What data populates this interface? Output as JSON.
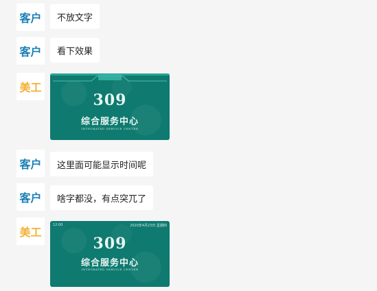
{
  "colors": {
    "customer": "#1a7fb6",
    "designer": "#f2b233",
    "card_bg": "#0f7a70"
  },
  "messages": [
    {
      "sender": "客户",
      "text": "不放文字"
    },
    {
      "sender": "客户",
      "text": "看下效果"
    },
    {
      "sender": "美工",
      "card": {
        "number": "309",
        "title": "综合服务中心",
        "subtitle": "INTEGRATED SERVICE CENTER"
      }
    },
    {
      "sender": "客户",
      "text": "这里面可能显示时间呢"
    },
    {
      "sender": "客户",
      "text": "啥字都没，有点突兀了"
    },
    {
      "sender": "美工",
      "card": {
        "time": "12:00",
        "date": "2020年4月23日 星期四",
        "number": "309",
        "title": "综合服务中心",
        "subtitle": "INTEGRATED SERVICE CENTER"
      }
    }
  ]
}
